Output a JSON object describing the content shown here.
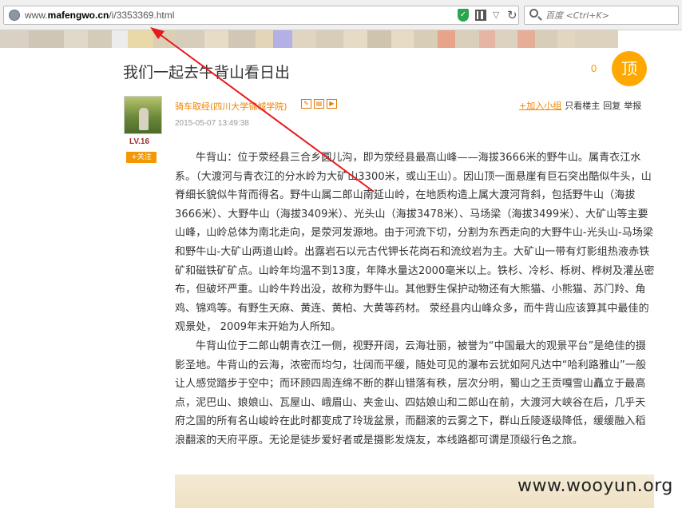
{
  "browser": {
    "url_prefix": "www.",
    "url_domain": "mafengwo.cn",
    "url_path": "/i/3353369.html",
    "search_placeholder": "百度 <Ctrl+K>",
    "dropdown_glyph": "▽",
    "refresh_glyph": "↻"
  },
  "post": {
    "title": "我们一起去牛背山看日出",
    "like_count": "0",
    "ding_label": "顶",
    "author": "骑车取经(四川大学锦城学院)",
    "level": "LV.16",
    "follow_label": "+关注",
    "time": "2015-05-07 13:49:38",
    "actions": {
      "join_group": "+加入小组",
      "only_author": "只看楼主",
      "reply": "回复",
      "report": "举报"
    },
    "paragraphs": [
      "牛背山：位于荥经县三合乡圆儿沟，即为荥经县最高山峰——海拔3666米的野牛山。属青衣江水系。（大渡河与青衣江的分水岭为大矿山3300米，或山王山）。因山顶一面悬崖有巨石突出酷似牛头，山脊细长貌似牛背而得名。野牛山属二郎山南延山岭，在地质构造上属大渡河背斜，包括野牛山（海拔3666米）、大野牛山（海拔3409米）、光头山（海拔3478米）、马场梁（海拔3499米）、大矿山等主要山峰，山岭总体为南北走向，是荥河发源地。由于河流下切，分割为东西走向的大野牛山-光头山-马场梁和野牛山-大矿山两道山岭。出露岩石以元古代钾长花岗石和流纹岩为主。大矿山一带有灯影组热液赤铁矿和磁铁矿矿点。山岭年均温不到13度，年降水量达2000毫米以上。铁杉、冷杉、栎树、桦树及灌丛密布，但破坏严重。山岭牛羚出没，故称为野牛山。其他野生保护动物还有大熊猫、小熊猫、苏门羚、角鸡、锦鸡等。有野生天麻、黄连、黄柏、大黄等药材。 荥经县内山峰众多，而牛背山应该算其中最佳的观景处， 2009年末开始为人所知。",
      "牛背山位于二郎山朝青衣江一侧，视野开阔，云海壮丽，被誉为“中国最大的观景平台”是绝佳的摄影圣地。牛背山的云海，浓密而均匀，壮阔而平缓，随处可见的瀑布云犹如阿凡达中“哈利路雅山”一般让人感觉踏步于空中；而环顾四周连绵不断的群山错落有秩，层次分明，蜀山之王贡嘎雪山矗立于最高点，泥巴山、娘娘山、瓦屋山、峨眉山、夹金山、四姑娘山和二郎山在前，大渡河大峡谷在后，几乎天府之国的所有名山峻岭在此时都变成了玲珑盆景，而翻滚的云雾之下，群山丘陵逐级降低，缓缓融入稻浪翻滚的天府平原。无论是徒步爱好者或是摄影发烧友，本线路都可谓是顶级行色之旅。"
    ]
  },
  "watermark": "www.wooyun.org",
  "colors": {
    "accent": "#f08300",
    "ding": "#ffa800",
    "arrow": "#e8191e"
  },
  "icons": {
    "shield": "shield-icon",
    "qr": "qrcode-icon",
    "search": "search-icon",
    "globe": "globe-icon"
  }
}
